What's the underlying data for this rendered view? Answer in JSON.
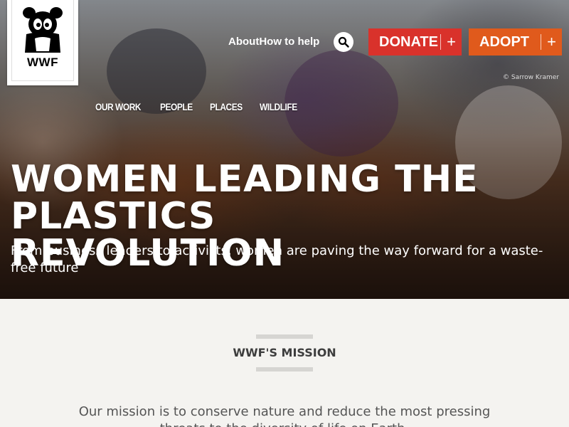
{
  "logo": {
    "text": "WWF",
    "icon": "panda-logo-icon"
  },
  "top_links": [
    {
      "label": "About"
    },
    {
      "label": "How to help"
    }
  ],
  "search": {
    "icon": "search-icon"
  },
  "donate": {
    "label": "DONATE",
    "icon": "plus-icon"
  },
  "adopt": {
    "label": "ADOPT",
    "icon": "plus-icon"
  },
  "photo_credit": "© Sarrow Kramer",
  "nav": [
    {
      "label": "OUR WORK"
    },
    {
      "label": "PEOPLE"
    },
    {
      "label": "PLACES"
    },
    {
      "label": "WILDLIFE"
    }
  ],
  "hero": {
    "headline": "WOMEN LEADING THE PLASTICS REVOLUTION",
    "subheadline": "From business leaders to activists, women are paving the way forward for a waste-free future"
  },
  "mission": {
    "title": "WWF'S MISSION",
    "body": "Our mission is to conserve nature and reduce the most pressing threats to the diversity of life on Earth."
  },
  "colors": {
    "donate": "#d9322b",
    "adopt": "#e05a1c",
    "background": "#f4f3f0"
  }
}
